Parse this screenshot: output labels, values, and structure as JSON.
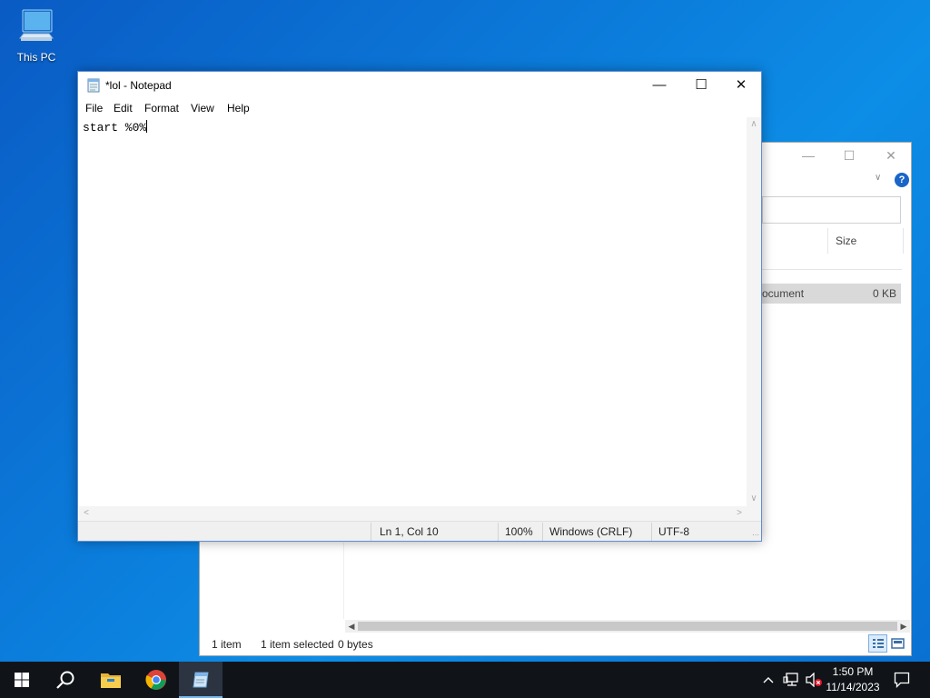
{
  "desktop": {
    "icons": [
      {
        "label": "This PC",
        "icon": "computer-icon"
      }
    ]
  },
  "explorer": {
    "column_size": "Size",
    "row": {
      "type_partial": "ocument",
      "size": "0 KB"
    },
    "status": {
      "count": "1 item",
      "selected": "1 item selected",
      "bytes": "0 bytes"
    }
  },
  "notepad": {
    "title": "*lol - Notepad",
    "menu": [
      "File",
      "Edit",
      "Format",
      "View",
      "Help"
    ],
    "content": "start %0%",
    "status": {
      "position": "Ln 1, Col 10",
      "zoom": "100%",
      "line_ending": "Windows (CRLF)",
      "encoding": "UTF-8"
    }
  },
  "taskbar": {
    "apps": [
      "windows-start-icon",
      "search-icon",
      "file-explorer-icon",
      "chrome-icon",
      "notepad-icon"
    ],
    "active_app": "notepad-icon",
    "tray": [
      "chevron-up-icon",
      "network-icon",
      "volume-muted-icon",
      "notifications-icon"
    ],
    "time": "1:50 PM",
    "date": "11/14/2023"
  },
  "colors": {
    "accent": "#0078d7",
    "taskbar": "#101418",
    "active_indicator": "#76b9ed"
  }
}
